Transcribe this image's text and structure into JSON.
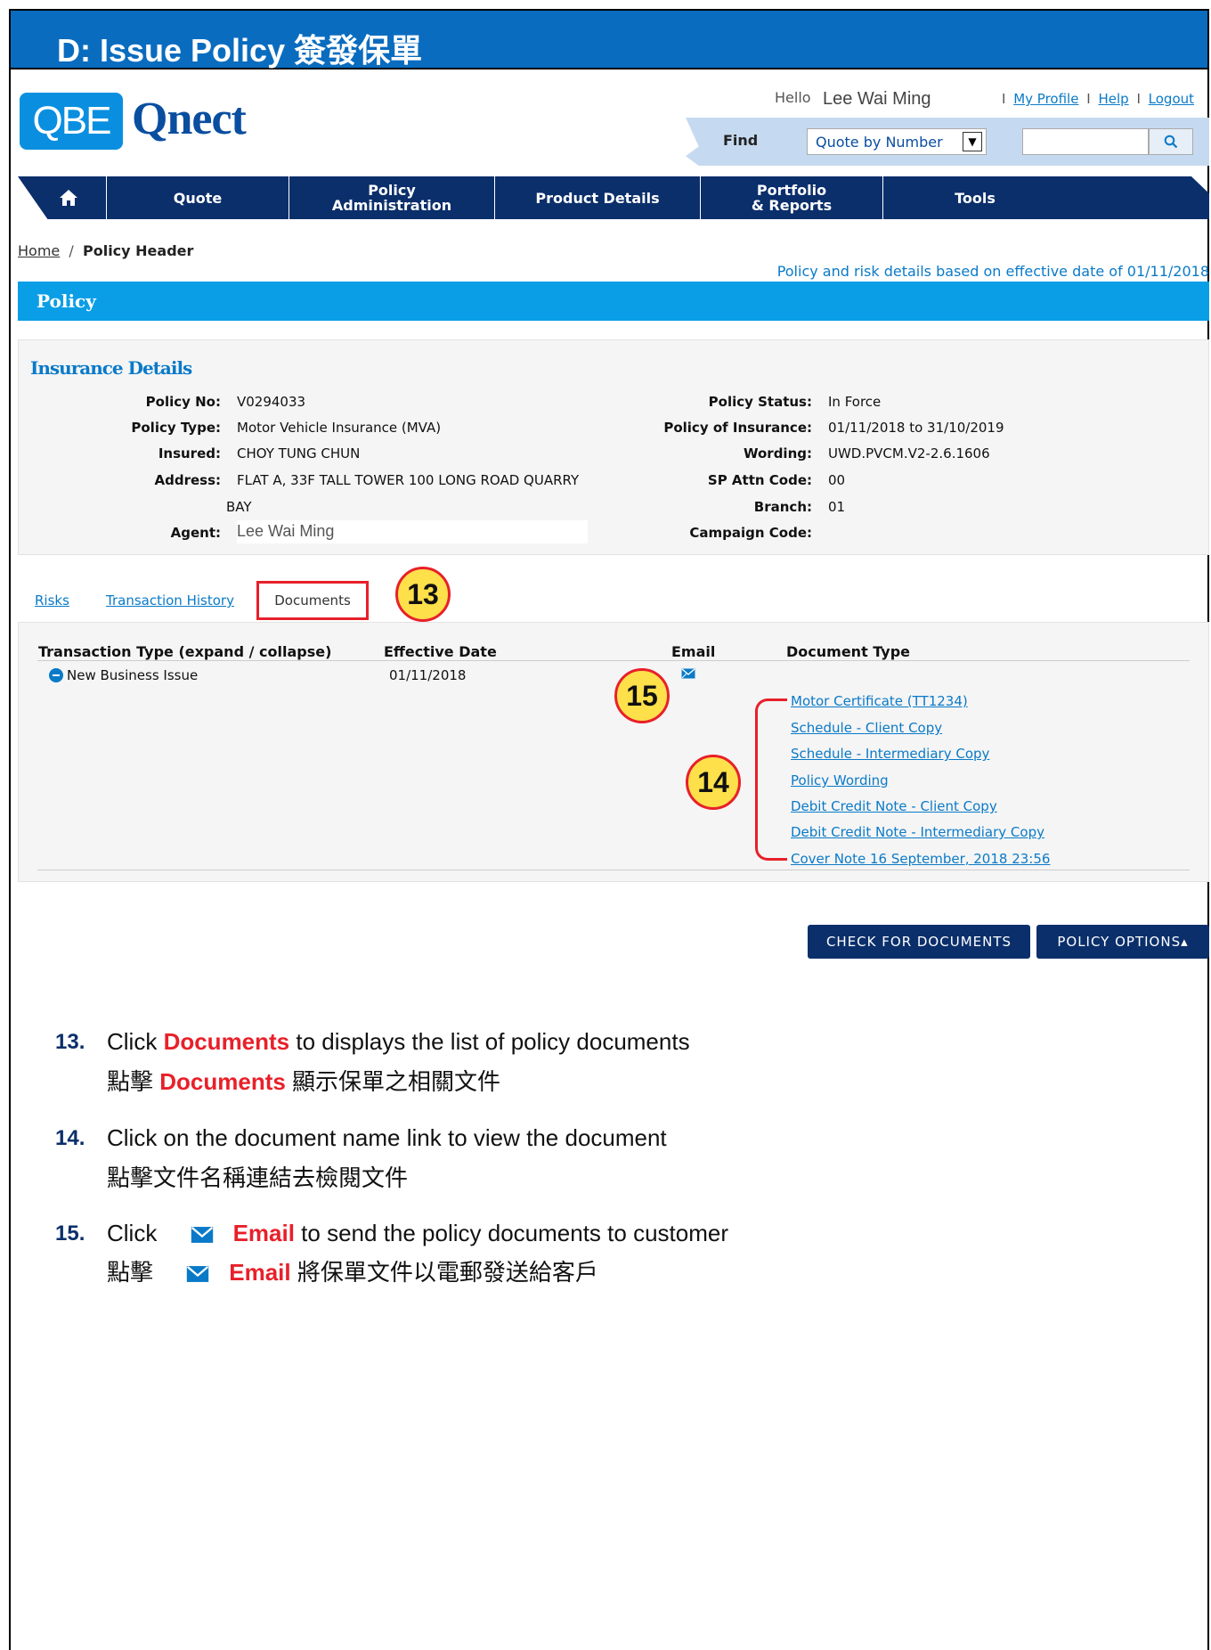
{
  "banner": {
    "title": "D: Issue Policy 簽發保單"
  },
  "header": {
    "logo_mark": "QBE",
    "logo_word": "Qnect",
    "hello": "Hello",
    "user_name": "Lee Wai Ming",
    "links": [
      "My Profile",
      "Help",
      "Logout"
    ],
    "find_label": "Find",
    "find_select": "Quote by Number",
    "search_placeholder": ""
  },
  "nav": {
    "home_icon": "home-icon",
    "items": [
      "Quote",
      "Policy Administration",
      "Product Details",
      "Portfolio & Reports",
      "Tools"
    ],
    "policy_admin_line1": "Policy",
    "policy_admin_line2": "Administration",
    "portfolio_line1": "Portfolio",
    "portfolio_line2": "& Reports"
  },
  "breadcrumb": {
    "home": "Home",
    "separator": "/",
    "current": "Policy Header"
  },
  "effective_note": "Policy and risk details based on effective date of 01/11/2018",
  "policy_bar": "Policy",
  "insurance_details": {
    "title": "Insurance Details",
    "left": [
      {
        "label": "Policy No:",
        "value": "V0294033"
      },
      {
        "label": "Policy Type:",
        "value": "Motor Vehicle Insurance (MVA)"
      },
      {
        "label": "Insured:",
        "value": "CHOY TUNG CHUN"
      },
      {
        "label": "Address:",
        "value": "FLAT A, 33F TALL TOWER 100 LONG ROAD QUARRY"
      },
      {
        "label": "",
        "value": "BAY"
      },
      {
        "label": "Agent:",
        "value": "Lee Wai Ming"
      }
    ],
    "right": [
      {
        "label": "Policy Status:",
        "value": "In Force"
      },
      {
        "label": "Policy of Insurance:",
        "value": "01/11/2018 to 31/10/2019"
      },
      {
        "label": "Wording:",
        "value": "UWD.PVCM.V2-2.6.1606"
      },
      {
        "label": "SP Attn Code:",
        "value": "00"
      },
      {
        "label": "Branch:",
        "value": "01"
      },
      {
        "label": "Campaign Code:",
        "value": ""
      }
    ]
  },
  "tabs": {
    "risks": "Risks",
    "history": "Transaction History",
    "documents": "Documents"
  },
  "callouts": [
    "13",
    "14",
    "15"
  ],
  "documents": {
    "headers": [
      "Transaction Type (expand / collapse)",
      "Effective Date",
      "Email",
      "Document Type"
    ],
    "row": {
      "type": "New Business Issue",
      "date": "01/11/2018",
      "email_icon": "envelope-icon"
    },
    "links": [
      "Motor Certificate (TT1234)",
      "Schedule - Client Copy",
      "Schedule - Intermediary Copy",
      "Policy Wording",
      "Debit Credit Note - Client Copy",
      "Debit Credit Note - Intermediary Copy",
      "Cover Note 16 September, 2018 23:56"
    ]
  },
  "buttons": {
    "check": "CHECK FOR DOCUMENTS",
    "options": "POLICY OPTIONS▴"
  },
  "steps": [
    {
      "num": "13.",
      "en_pre": "Click ",
      "en_hl": "Documents",
      "en_post": " to displays the list of policy documents",
      "zh_pre": "點擊 ",
      "zh_hl": "Documents",
      "zh_post": " 顯示保單之相關文件"
    },
    {
      "num": "14.",
      "en": "Click on the document name link to view the document",
      "zh": "點擊文件名稱連結去檢閱文件"
    },
    {
      "num": "15.",
      "en_pre": "Click",
      "en_hl": "Email",
      "en_post": " to send the policy documents to customer",
      "zh_pre": "點擊",
      "zh_hl": "Email",
      "zh_post": " 將保單文件以電郵發送給客戶"
    }
  ],
  "colors": {
    "brand_navy": "#0b2f6b",
    "brand_blue": "#0a9ee6",
    "link": "#0a7ac8",
    "highlight_red": "#e8202a",
    "callout_yellow": "#fde04a"
  }
}
